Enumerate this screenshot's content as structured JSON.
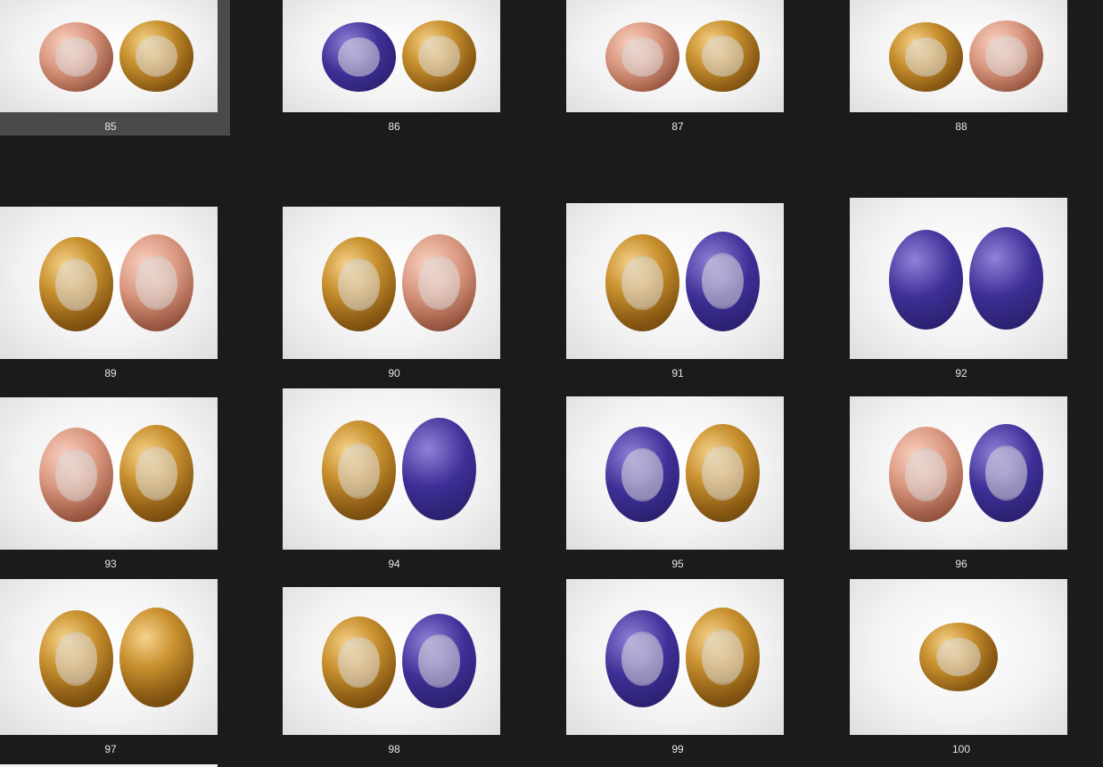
{
  "thumbnails": [
    {
      "label": "85",
      "colors": [
        "rose",
        "gold"
      ]
    },
    {
      "label": "86",
      "colors": [
        "blue",
        "gold"
      ]
    },
    {
      "label": "87",
      "colors": [
        "rose",
        "gold"
      ]
    },
    {
      "label": "88",
      "colors": [
        "gold",
        "rose"
      ]
    },
    {
      "label": "89",
      "colors": [
        "gold",
        "rose"
      ]
    },
    {
      "label": "90",
      "colors": [
        "gold",
        "rose"
      ]
    },
    {
      "label": "91",
      "colors": [
        "gold",
        "blue"
      ]
    },
    {
      "label": "92",
      "colors": [
        "blue",
        "blue"
      ]
    },
    {
      "label": "93",
      "colors": [
        "rose",
        "gold"
      ]
    },
    {
      "label": "94",
      "colors": [
        "gold",
        "blue"
      ]
    },
    {
      "label": "95",
      "colors": [
        "blue",
        "gold"
      ]
    },
    {
      "label": "96",
      "colors": [
        "rose",
        "blue"
      ]
    },
    {
      "label": "97",
      "colors": [
        "gold",
        "gold"
      ]
    },
    {
      "label": "98",
      "colors": [
        "gold",
        "blue"
      ]
    },
    {
      "label": "99",
      "colors": [
        "blue",
        "gold"
      ]
    },
    {
      "label": "100",
      "colors": [
        "gold"
      ]
    }
  ],
  "selected": "85"
}
